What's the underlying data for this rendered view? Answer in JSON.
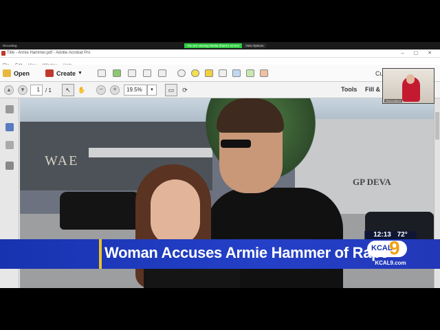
{
  "zoom": {
    "recording_label": "Recording",
    "share_banner": "You are viewing Media Share's screen",
    "view_options": "View Options"
  },
  "window": {
    "title": "Title - Armie Hammer.pdf - Adobe Acrobat Pro",
    "controls": "– ▢ ✕"
  },
  "menu": [
    "File",
    "Edit",
    "View",
    "Window",
    "Help"
  ],
  "toolbar": {
    "open_label": "Open",
    "create_label": "Create",
    "customize_label": "Cu"
  },
  "nav": {
    "page_current": "1",
    "page_total": "/ 1",
    "zoom_level": "19.5%",
    "tools_label": "Tools",
    "fill_sign_label": "Fill &"
  },
  "photo": {
    "store_sign_left": "WAE",
    "store_sign_right": "GP DEVA"
  },
  "broadcast": {
    "headline": "Woman Accuses Armie Hammer of Rape",
    "clock": "12:13",
    "temperature": "72°",
    "station_short": "KCAL",
    "station_number": "9",
    "station_site": "KCAL9.com"
  },
  "pip": {
    "label": "Gloria Allred"
  },
  "colors": {
    "lower_third_blue": "#1833b0",
    "lower_third_accent": "#f0c020",
    "kcal_orange": "#f0a010"
  }
}
